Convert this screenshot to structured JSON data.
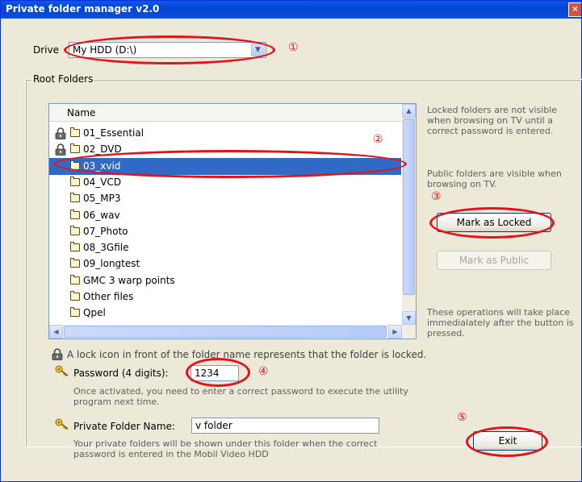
{
  "window": {
    "title": "Private folder manager v2.0",
    "close_glyph": "×"
  },
  "drive": {
    "label": "Drive",
    "value": "My HDD (D:\\)"
  },
  "root_folders": {
    "label": "Root Folders",
    "column_header": "Name",
    "folders": [
      {
        "name": "01_Essential",
        "locked": true,
        "selected": false
      },
      {
        "name": "02_DVD",
        "locked": true,
        "selected": false
      },
      {
        "name": "03_xvid",
        "locked": false,
        "selected": true
      },
      {
        "name": "04_VCD",
        "locked": false,
        "selected": false
      },
      {
        "name": "05_MP3",
        "locked": false,
        "selected": false
      },
      {
        "name": "06_wav",
        "locked": false,
        "selected": false
      },
      {
        "name": "07_Photo",
        "locked": false,
        "selected": false
      },
      {
        "name": "08_3Gfile",
        "locked": false,
        "selected": false
      },
      {
        "name": "09_longtest",
        "locked": false,
        "selected": false
      },
      {
        "name": "GMC 3 warp points",
        "locked": false,
        "selected": false
      },
      {
        "name": "Other files",
        "locked": false,
        "selected": false
      },
      {
        "name": "Qpel",
        "locked": false,
        "selected": false
      }
    ]
  },
  "side_panel": {
    "locked_info": "Locked folders are not visible when browsing on TV until a correct password is entered.",
    "public_info": "Public folders are visible when browsing on TV.",
    "mark_locked_button": "Mark as Locked",
    "mark_public_button": "Mark as Public",
    "operations_info": "These operations will take place immedialately after the button is pressed."
  },
  "lock_legend": "A lock icon in front of the folder name represents that the folder is locked.",
  "password": {
    "label": "Password (4 digits):",
    "value": "1234",
    "hint": "Once activated, you need to enter a correct password to execute the utility program next time."
  },
  "private_folder": {
    "label": "Private Folder Name:",
    "value": "v folder",
    "hint": "Your private folders will be shown under this folder when the correct password is entered in the Mobil Video HDD"
  },
  "exit_button": "Exit",
  "annotations": {
    "m1": "①",
    "m2": "②",
    "m3": "③",
    "m4": "④",
    "m5": "⑤"
  },
  "colors": {
    "annotation_red": "#e3121b",
    "selection_blue": "#316ac5",
    "titlebar_blue": "#0345d6"
  }
}
